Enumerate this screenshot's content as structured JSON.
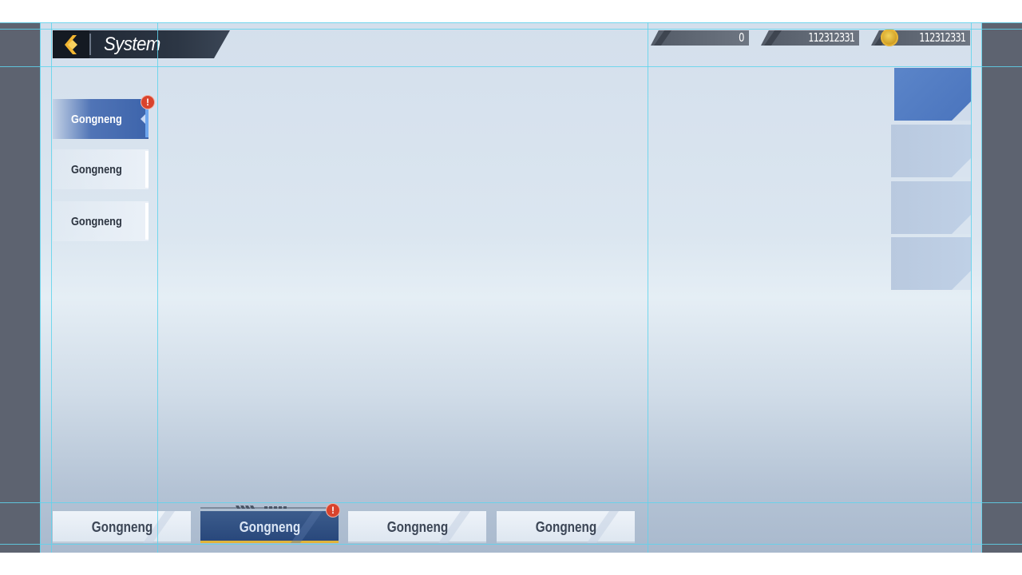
{
  "header": {
    "title": "System",
    "back_icon": "chevron-left-icon"
  },
  "currencies": [
    {
      "name": "currency-1",
      "value": "0"
    },
    {
      "name": "currency-2",
      "value": "112312331"
    },
    {
      "name": "currency-3",
      "value": "112312331",
      "icon": "coin-icon"
    }
  ],
  "left_nav": [
    {
      "label": "Gongneng",
      "active": true,
      "alert": "!"
    },
    {
      "label": "Gongneng",
      "active": false
    },
    {
      "label": "Gongneng",
      "active": false
    }
  ],
  "bottom_tabs": [
    {
      "label": "Gongneng",
      "active": false
    },
    {
      "label": "Gongneng",
      "active": true,
      "alert": "!"
    },
    {
      "label": "Gongneng",
      "active": false
    },
    {
      "label": "Gongneng",
      "active": false
    }
  ],
  "colors": {
    "accent_blue": "#4a74bd",
    "alert_red": "#d9432c",
    "gold": "#e0b43a"
  }
}
